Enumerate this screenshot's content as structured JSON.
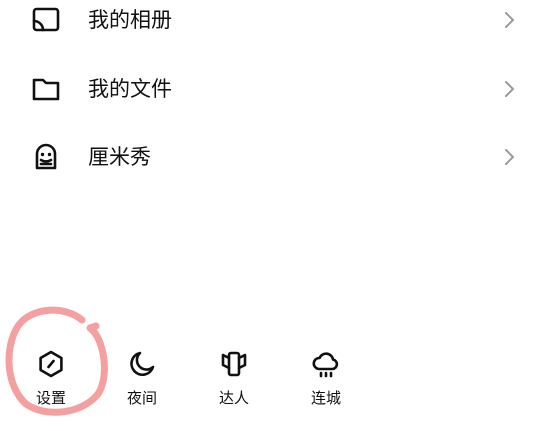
{
  "menu": {
    "items": [
      {
        "label": "我的相册",
        "icon": "album-cast-icon"
      },
      {
        "label": "我的文件",
        "icon": "folder-icon"
      },
      {
        "label": "厘米秀",
        "icon": "cmshow-face-icon"
      }
    ]
  },
  "bottom_bar": {
    "items": [
      {
        "label": "设置",
        "icon": "settings-hexagon-icon"
      },
      {
        "label": "夜间",
        "icon": "moon-icon"
      },
      {
        "label": "达人",
        "icon": "phone-wings-icon"
      },
      {
        "label": "连城",
        "icon": "cloud-rain-icon"
      }
    ]
  },
  "colors": {
    "text": "#111111",
    "chevron": "#9a9a9a",
    "highlight": "#f4a0a0",
    "background": "#ffffff"
  }
}
